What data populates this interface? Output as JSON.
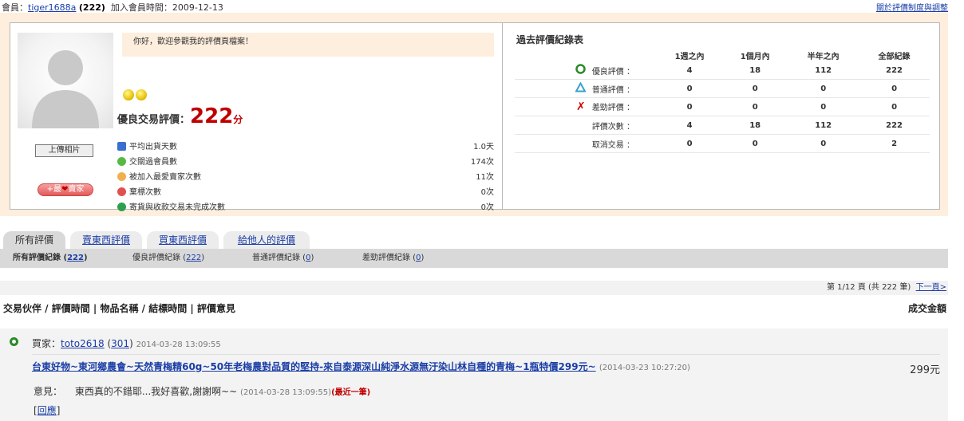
{
  "topbar": {
    "member_label": "會員：",
    "username": "tiger1688a",
    "score": "(222)",
    "join_label": "加入會員時間：2009-12-13",
    "policy_link": "關於評價制度與調整"
  },
  "profile": {
    "welcome": "你好，歡迎參觀我的評價頁檔案！",
    "upload_label": "上傳相片",
    "fav_label_left": "+最",
    "fav_label_right": "賣家",
    "rating_label": "優良交易評價：",
    "rating_value": "222",
    "rating_unit": "分",
    "stats": [
      {
        "label": "平均出貨天數",
        "value": "1.0天",
        "icon": "truck-icon",
        "color": "#3a6fd0"
      },
      {
        "label": "交關過會員數",
        "value": "174次",
        "icon": "user-icon",
        "color": "#57b846"
      },
      {
        "label": "被加入最愛賣家次數",
        "value": "11次",
        "icon": "user-fav-icon",
        "color": "#f0b050"
      },
      {
        "label": "棄標次數",
        "value": "0次",
        "icon": "sad-face-icon",
        "color": "#e05050"
      },
      {
        "label": "寄貨與收款交易未完成次數",
        "value": "0次",
        "icon": "neutral-face-icon",
        "color": "#2f9f4f"
      }
    ]
  },
  "history": {
    "title": "過去評價紀錄表",
    "columns": [
      "1週之內",
      "1個月內",
      "半年之內",
      "全部紀錄"
    ],
    "rows": [
      {
        "label": "優良評價 ：",
        "symbol": "good",
        "values": [
          "4",
          "18",
          "112",
          "222"
        ]
      },
      {
        "label": "普通評價 ：",
        "symbol": "normal",
        "values": [
          "0",
          "0",
          "0",
          "0"
        ]
      },
      {
        "label": "差勁評價 ：",
        "symbol": "bad",
        "values": [
          "0",
          "0",
          "0",
          "0"
        ]
      },
      {
        "label": "評價次數 ：",
        "symbol": "",
        "values": [
          "4",
          "18",
          "112",
          "222"
        ]
      },
      {
        "label": "取消交易 ：",
        "symbol": "",
        "values": [
          "0",
          "0",
          "0",
          "2"
        ]
      }
    ]
  },
  "tabs": [
    "所有評價",
    "賣東西評價",
    "買東西評價",
    "給他人的評價"
  ],
  "subtabs": [
    {
      "label": "所有評價紀錄 (",
      "count": "222",
      "suffix": ")"
    },
    {
      "label": "優良評價紀錄 (",
      "count": "222",
      "suffix": ")"
    },
    {
      "label": "普通評價紀錄 (",
      "count": "0",
      "suffix": ")"
    },
    {
      "label": "差勁評價紀錄 (",
      "count": "0",
      "suffix": ")"
    }
  ],
  "pager": {
    "text": "第 1/12 頁 (共 222 筆)",
    "next": "下一頁>"
  },
  "list_header": {
    "left": "交易伙伴 / 評價時間 | 物品名稱 / 結標時間 | 評價意見",
    "right": "成交金額"
  },
  "entry": {
    "buyer_label": "買家：",
    "buyer": "toto2618",
    "buyer_score": "301",
    "buyer_time": "2014-03-28 13:09:55",
    "item": "台東好物~東河鄉農會~天然青梅精60g~50年老梅農對品質的堅持-來自泰源深山純淨水源無汙染山林自種的青梅~1瓶特價299元~",
    "item_time": "(2014-03-23 10:27:20)",
    "price": "299元",
    "comment_label": "意見：",
    "comment": "東西真的不錯耶...我好喜歡,謝謝啊~~",
    "comment_time": "(2014-03-28 13:09:55)",
    "recent": "(最近一筆)",
    "reply": "回應"
  },
  "colors": {
    "accent_red": "#c00000",
    "link": "#1a3da6",
    "profile_bg": "#fdeedd",
    "good": "#2a8a2a",
    "normal": "#3aa0d0",
    "bad": "#d00000"
  }
}
